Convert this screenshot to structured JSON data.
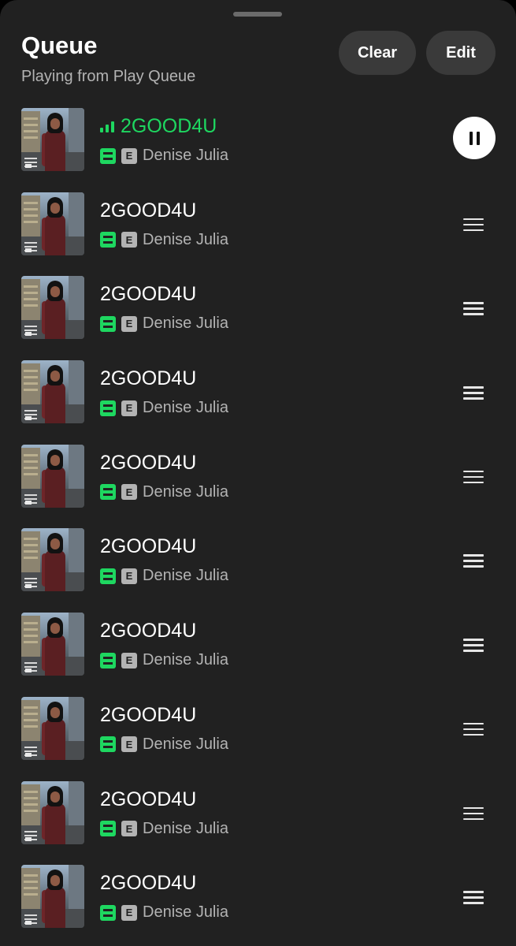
{
  "header": {
    "title": "Queue",
    "subtitle": "Playing from Play Queue",
    "clear_label": "Clear",
    "edit_label": "Edit"
  },
  "colors": {
    "accent": "#1ed760",
    "background": "#212121",
    "pill": "#3a3a3a",
    "secondary_text": "#b3b3b3"
  },
  "queue": [
    {
      "title": "2GOOD4U",
      "artist": "Denise Julia",
      "explicit_label": "E",
      "downloaded": true,
      "now_playing": true
    },
    {
      "title": "2GOOD4U",
      "artist": "Denise Julia",
      "explicit_label": "E",
      "downloaded": true
    },
    {
      "title": "2GOOD4U",
      "artist": "Denise Julia",
      "explicit_label": "E",
      "downloaded": true
    },
    {
      "title": "2GOOD4U",
      "artist": "Denise Julia",
      "explicit_label": "E",
      "downloaded": true
    },
    {
      "title": "2GOOD4U",
      "artist": "Denise Julia",
      "explicit_label": "E",
      "downloaded": true
    },
    {
      "title": "2GOOD4U",
      "artist": "Denise Julia",
      "explicit_label": "E",
      "downloaded": true
    },
    {
      "title": "2GOOD4U",
      "artist": "Denise Julia",
      "explicit_label": "E",
      "downloaded": true
    },
    {
      "title": "2GOOD4U",
      "artist": "Denise Julia",
      "explicit_label": "E",
      "downloaded": true
    },
    {
      "title": "2GOOD4U",
      "artist": "Denise Julia",
      "explicit_label": "E",
      "downloaded": true
    },
    {
      "title": "2GOOD4U",
      "artist": "Denise Julia",
      "explicit_label": "E",
      "downloaded": true
    }
  ],
  "icons": {
    "now_playing": "equalizer-bars-icon",
    "downloaded": "downloaded-icon",
    "explicit": "explicit-badge",
    "pause": "pause-icon",
    "reorder": "drag-handle-icon"
  }
}
